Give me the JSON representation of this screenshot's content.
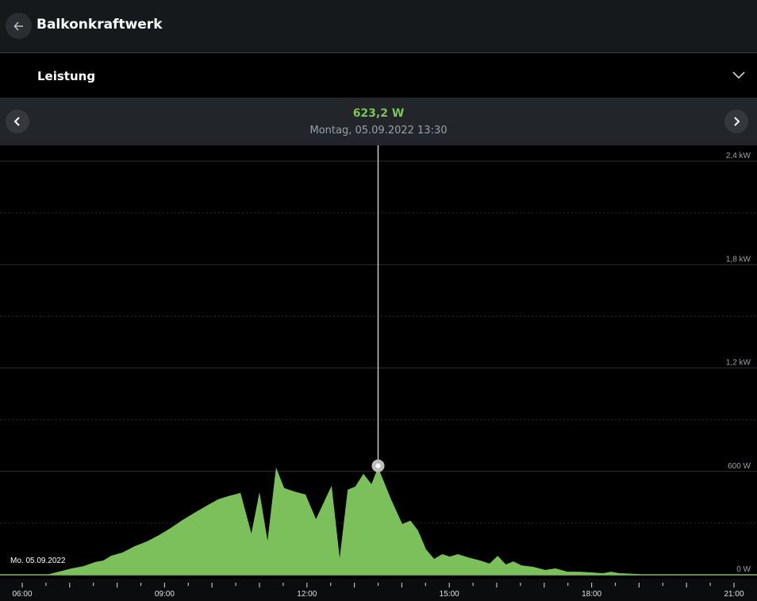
{
  "header": {
    "title": "Balkonkraftwerk",
    "back_icon": "arrow-left-icon"
  },
  "selector": {
    "label": "Leistung",
    "icon": "chevron-down-icon"
  },
  "nav": {
    "value": "623,2 W",
    "timestamp": "Montag, 05.09.2022 13:30",
    "prev_icon": "chevron-left-icon",
    "next_icon": "chevron-right-icon"
  },
  "colors": {
    "accent": "#7dc35a",
    "fill": "#7cc05c"
  },
  "chart_data": {
    "type": "area",
    "title": "Leistung",
    "date_label": "Mo. 05.09.2022",
    "xlabel": "",
    "ylabel": "W",
    "xlim": [
      6,
      21
    ],
    "ylim": [
      0,
      2400
    ],
    "y_ticks": [
      {
        "v": 2400,
        "label": "2,4 kW"
      },
      {
        "v": 1800,
        "label": "1,8 kW"
      },
      {
        "v": 1200,
        "label": "1,2 kW"
      },
      {
        "v": 600,
        "label": "600 W"
      },
      {
        "v": 0,
        "label": "0 W"
      }
    ],
    "x_ticks": [
      {
        "v": 6,
        "label": "06:00"
      },
      {
        "v": 9,
        "label": "09:00"
      },
      {
        "v": 12,
        "label": "12:00"
      },
      {
        "v": 15,
        "label": "15:00"
      },
      {
        "v": 18,
        "label": "18:00"
      },
      {
        "v": 21,
        "label": "21:00"
      }
    ],
    "selected": {
      "x": 13.5,
      "y": 623.2
    },
    "series": [
      {
        "name": "Leistung",
        "x": [
          6.0,
          6.54,
          6.79,
          7.04,
          7.29,
          7.54,
          7.71,
          7.87,
          8.12,
          8.37,
          8.63,
          8.88,
          9.13,
          9.38,
          9.63,
          9.88,
          10.13,
          10.35,
          10.6,
          10.83,
          11.0,
          11.17,
          11.35,
          11.52,
          11.77,
          11.97,
          12.19,
          12.52,
          12.69,
          12.86,
          13.02,
          13.19,
          13.36,
          13.5,
          13.78,
          14.01,
          14.18,
          14.34,
          14.51,
          14.68,
          14.85,
          15.01,
          15.18,
          15.4,
          15.65,
          15.85,
          16.02,
          16.19,
          16.35,
          16.52,
          16.77,
          17.02,
          17.24,
          17.49,
          17.74,
          17.99,
          18.24,
          18.41,
          18.58,
          18.91,
          19.08,
          20.67
        ],
        "y": [
          0,
          2,
          20,
          37,
          50,
          74,
          83,
          110,
          130,
          166,
          194,
          230,
          272,
          318,
          360,
          400,
          438,
          457,
          475,
          240,
          480,
          198,
          623,
          503,
          480,
          466,
          323,
          517,
          97,
          494,
          512,
          586,
          526,
          623,
          434,
          295,
          314,
          258,
          148,
          92,
          120,
          106,
          120,
          101,
          83,
          65,
          110,
          60,
          78,
          55,
          46,
          28,
          37,
          18,
          18,
          14,
          9,
          18,
          9,
          5,
          2,
          2
        ]
      }
    ]
  }
}
